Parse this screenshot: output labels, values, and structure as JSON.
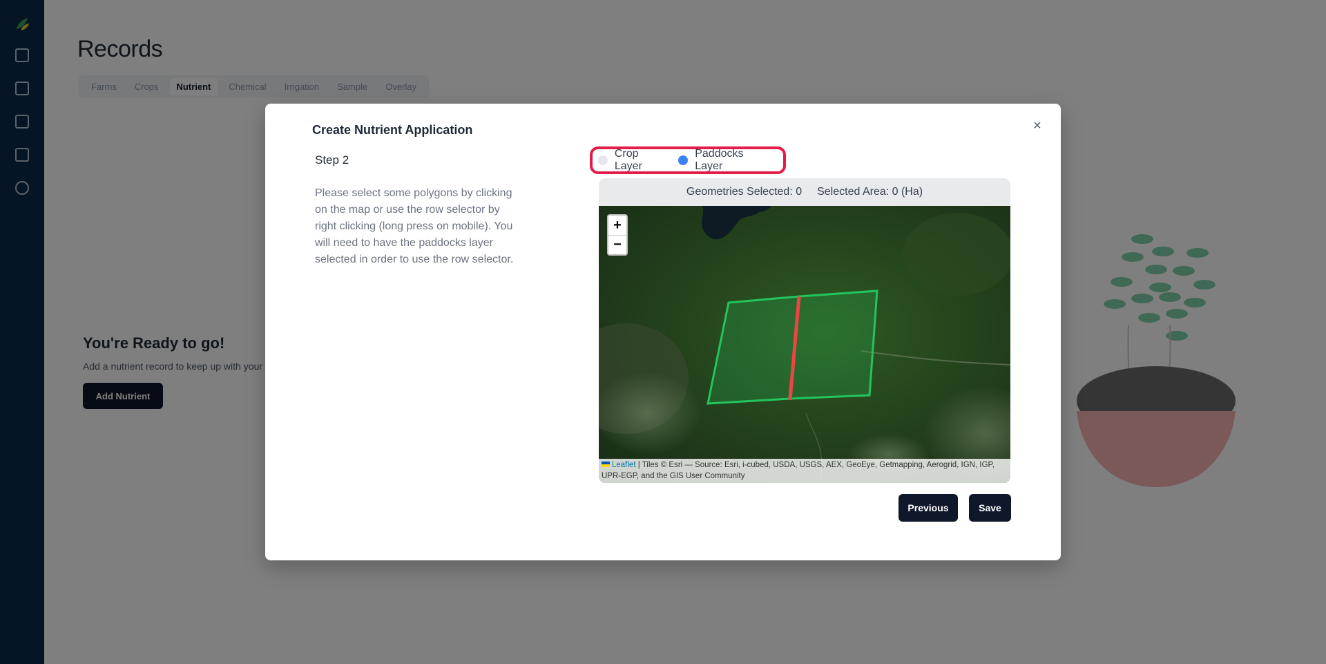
{
  "background": {
    "page_title": "Records",
    "tabs": [
      "Farms",
      "Crops",
      "Nutrient",
      "Chemical",
      "Irrigation",
      "Sample",
      "Overlay"
    ],
    "active_tab": "Nutrient",
    "empty_state": {
      "title": "You're Ready to go!",
      "subtitle": "Add a nutrient record to keep up with your farm records",
      "button_label": "Add Nutrient"
    }
  },
  "modal": {
    "title": "Create Nutrient Application",
    "close_glyph": "×",
    "step_label": "Step 2",
    "description": "Please select some polygons by clicking on the map or use the row selector by right clicking (long press on mobile). You will need to have the paddocks layer selected in order to use the row selector.",
    "layers": {
      "crop_label": "Crop Layer",
      "paddocks_label": "Paddocks Layer",
      "selected": "Paddocks Layer"
    },
    "map": {
      "geometries_selected": "Geometries Selected: 0",
      "selected_area": "Selected Area: 0 (Ha)",
      "zoom_in": "+",
      "zoom_out": "−",
      "attribution_link": "Leaflet",
      "attribution_text": " | Tiles © Esri — Source: Esri, i-cubed, USDA, USGS, AEX, GeoEye, Getmapping, Aerogrid, IGN, IGP, UPR-EGP, and the GIS User Community"
    },
    "buttons": {
      "previous": "Previous",
      "save": "Save"
    }
  },
  "colors": {
    "overlay": "#000000",
    "primary_button": "#0f172a",
    "highlight_border": "#e11d48",
    "radio_checked": "#3b82f6",
    "paddock_outline": "#22c55e",
    "row_line": "#ef4444"
  }
}
